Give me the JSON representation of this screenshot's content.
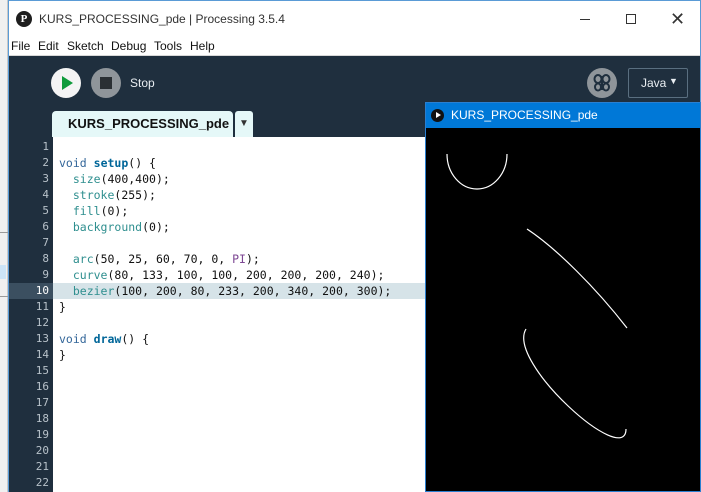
{
  "window": {
    "title": "KURS_PROCESSING_pde | Processing 3.5.4",
    "app_icon_glyph": "P"
  },
  "menu": {
    "items": [
      "File",
      "Edit",
      "Sketch",
      "Debug",
      "Tools",
      "Help"
    ]
  },
  "toolbar": {
    "stop_label": "Stop",
    "mode_label": "Java",
    "mode_caret": "▼"
  },
  "tab": {
    "label": "KURS_PROCESSING_pde",
    "menu_glyph": "▼"
  },
  "editor": {
    "current_line": 10,
    "line_numbers": [
      "1",
      "2",
      "3",
      "4",
      "5",
      "6",
      "7",
      "8",
      "9",
      "10",
      "11",
      "12",
      "13",
      "14",
      "15",
      "16",
      "17",
      "18",
      "19",
      "20",
      "21",
      "22"
    ],
    "lines": [
      "",
      "void setup() {",
      "  size(400,400);",
      "  stroke(255);",
      "  fill(0);",
      "  background(0);",
      "",
      "  arc(50, 25, 60, 70, 0, PI);",
      "  curve(80, 133, 100, 100, 200, 200, 200, 240);",
      "  bezier(100, 200, 80, 233, 200, 340, 200, 300);",
      "}",
      "",
      "void draw() {",
      "}",
      "",
      "",
      "",
      "",
      "",
      "",
      "",
      ""
    ]
  },
  "sketch": {
    "title": "KURS_PROCESSING_pde"
  },
  "colors": {
    "toolbar_bg": "#1f2f3e",
    "play_green": "#0f9b3b",
    "tab_bg": "#e5f8f8",
    "sketch_title_blue": "#0078d7"
  },
  "icons": {
    "play": "play-icon",
    "stop": "stop-icon",
    "debug": "butterfly-debug-icon",
    "close": "close-icon",
    "minimize": "minimize-icon",
    "maximize": "maximize-icon"
  }
}
